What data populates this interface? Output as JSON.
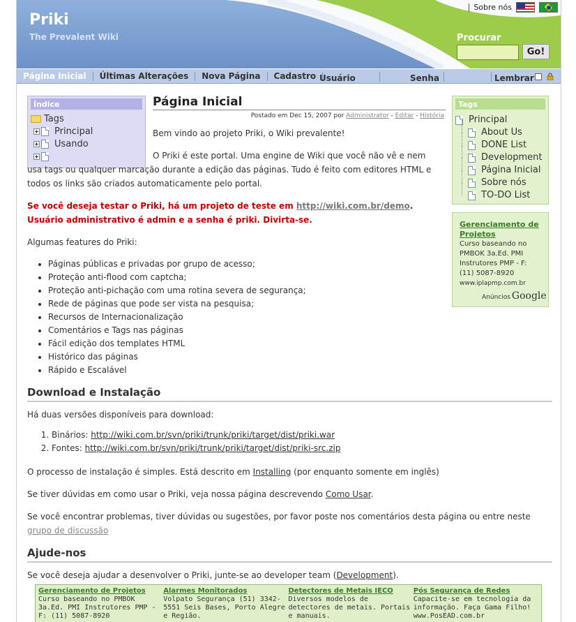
{
  "header": {
    "logo": "Priki",
    "tagline": "The Prevalent Wiki",
    "about_link": "Sobre nós",
    "search_label": "Procurar",
    "search_value": "",
    "go_button": "Go!"
  },
  "nav": {
    "items": [
      "Página Inicial",
      "Últimas Alterações",
      "Nova Página",
      "Cadastro"
    ],
    "user_label": "Usuário",
    "password_label": "Senha",
    "remember_label": "Lembrar"
  },
  "index": {
    "title": "Índice",
    "root": "Tags",
    "children": [
      "Principal",
      "Usando",
      ""
    ]
  },
  "page": {
    "title": "Página Inicial",
    "meta_prefix": "Postado em Dec 15, 2007 por",
    "author": "Administrator",
    "edit_link": "Editar",
    "history_link": "História",
    "welcome": "Bem vindo ao projeto Priki, o Wiki prevalente!",
    "intro_a": "O Priki é este portal. Uma engine de Wiki que você não vê e nem usa tags ou qualquer marcação durante a edição das páginas. Tudo é feito com editores HTML e todos os links são criados automaticamente pelo portal.",
    "test_a": "Se você deseja testar o Priki, há um projeto de teste em ",
    "test_link": "http://wiki.com.br/demo",
    "test_b": ". Usuário administrativo é admin e a senha é priki. Divirta-se.",
    "features_intro": "Algumas features do Priki:",
    "features": [
      "Páginas públicas e privadas por grupo de acesso;",
      "Proteção anti-flood com captcha;",
      "Proteção anti-pichação com uma rotina severa de segurança;",
      "Rede de páginas que pode ser vista na pesquisa;",
      "Recursos de Internacionalização",
      "Comentários e Tags nas páginas",
      "Fácil edição dos templates HTML",
      "Histórico das páginas",
      "Rápido e Escalável"
    ],
    "download_heading": "Download e Instalação",
    "download_intro": "Há duas versões disponíveis para download:",
    "downloads": [
      {
        "label": "Binários: ",
        "url": "http://wiki.com.br/svn/priki/trunk/priki/target/dist/priki.war"
      },
      {
        "label": "Fontes: ",
        "url": "http://wiki.com.br/svn/priki/trunk/priki/target/dist/priki-src.zip"
      }
    ],
    "install_a": "O processo de instalação é simples. Está descrito em ",
    "install_link": "Installing",
    "install_b": " (por enquanto somente em inglês)",
    "howto_a": "Se tiver dúvidas em como usar o Priki, veja nossa página descrevendo ",
    "howto_link": "Como Usar",
    "howto_b": ".",
    "problems_a": "Se você encontrar problemas, tiver dúvidas ou sugestões, por favor poste nos comentários desta página ou entre neste ",
    "problems_link": "grupo de discussão",
    "help_heading": "Ajude-nos",
    "help_a": "Se você deseja ajudar a desenvolver o Priki, junte-se ao developer team (",
    "help_link": "Development",
    "help_b": ")."
  },
  "tags": {
    "title": "Tags",
    "root": "Principal",
    "children": [
      "About Us",
      "DONE List",
      "Development",
      "Página Inicial",
      "Sobre nós",
      "TO-DO List"
    ]
  },
  "side_ad": {
    "title": "Gerenciamento de Projetos",
    "body": "Curso baseando no PMBOK 3a.Ed. PMI Instrutores PMP - F: (11) 5087-8920",
    "url": "www.iplapmp.com.br",
    "ads_by": "Anúncios",
    "google": "Google"
  },
  "bottom_ads": [
    {
      "title": "Gerenciamento de Projetos",
      "body": "Curso baseando no PMBOK 3a.Ed. PMI Instrutores PMP - F: (11) 5087-8920"
    },
    {
      "title": "Alarmes Monitorados",
      "body": "Volpato Segurança (51) 3342-5551 Seis Bases, Porto Alegre e Região."
    },
    {
      "title": "Detectores de Metais IECO",
      "body": "Diversos modelos de detectores de metais. Portais e manuais."
    },
    {
      "title": "Pós Segurança de Redes",
      "body": "Capacite-se em tecnologia da informação. Faça Gama Filho! www.PosEAD.com.br"
    }
  ]
}
